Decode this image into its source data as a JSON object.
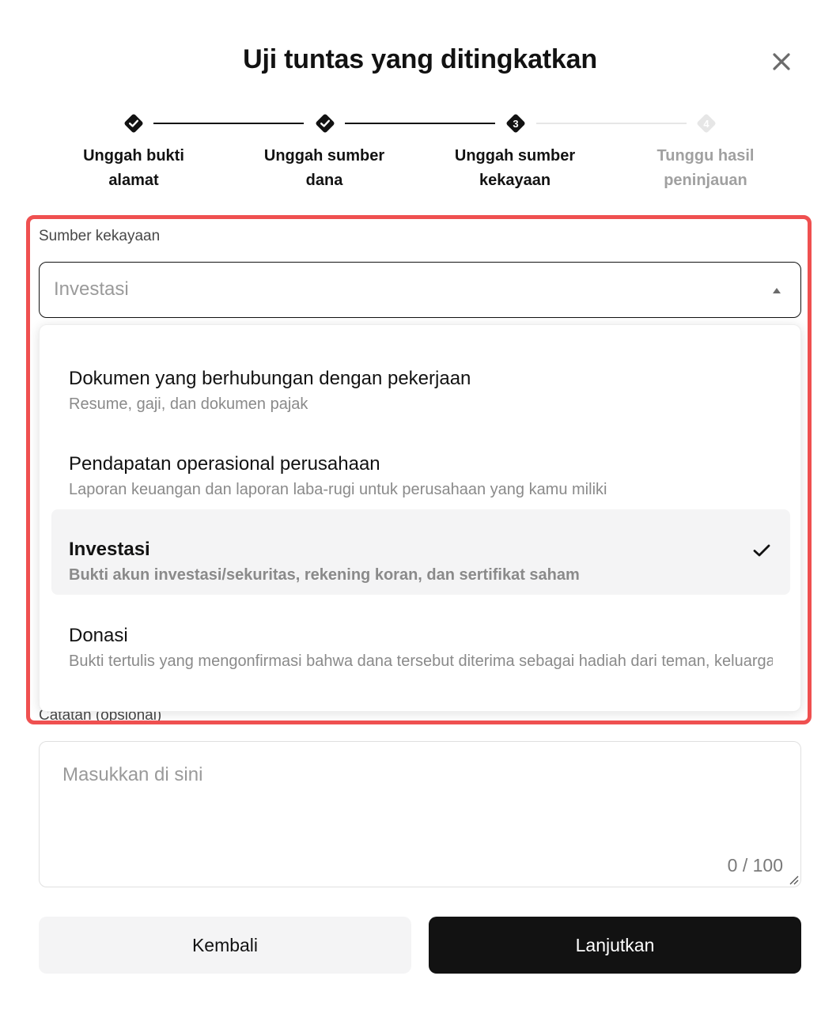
{
  "modal": {
    "title": "Uji tuntas yang ditingkatkan",
    "close_icon": "close-icon"
  },
  "stepper": {
    "steps": [
      {
        "line1": "Unggah bukti",
        "line2": "alamat",
        "status": "done"
      },
      {
        "line1": "Unggah sumber",
        "line2": "dana",
        "status": "done"
      },
      {
        "line1": "Unggah sumber",
        "line2": "kekayaan",
        "status": "current",
        "number": "3"
      },
      {
        "line1": "Tunggu hasil",
        "line2": "peninjauan",
        "status": "pending",
        "number": "4"
      }
    ]
  },
  "wealth_source": {
    "label": "Sumber kekayaan",
    "selected_value": "Investasi",
    "options": [
      {
        "title": "Dokumen yang berhubungan dengan pekerjaan",
        "desc": "Resume, gaji, dan dokumen pajak"
      },
      {
        "title": "Pendapatan operasional perusahaan",
        "desc": "Laporan keuangan dan laporan laba-rugi untuk perusahaan yang kamu miliki"
      },
      {
        "title": "Investasi",
        "desc": "Bukti akun investasi/sekuritas, rekening koran, dan sertifikat saham",
        "selected": true
      },
      {
        "title": "Donasi",
        "desc": "Bukti tertulis yang mengonfirmasi bahwa dana tersebut diterima sebagai hadiah dari teman, keluarga, atau lainnya"
      }
    ]
  },
  "notes": {
    "label": "Catatan (opsional)",
    "placeholder": "Masukkan di sini",
    "counter": "0 / 100"
  },
  "actions": {
    "back_label": "Kembali",
    "next_label": "Lanjutkan"
  },
  "colors": {
    "primary": "#121212",
    "highlight": "#ef5050",
    "muted": "#9a9a9a",
    "surface": "#f4f4f5"
  }
}
